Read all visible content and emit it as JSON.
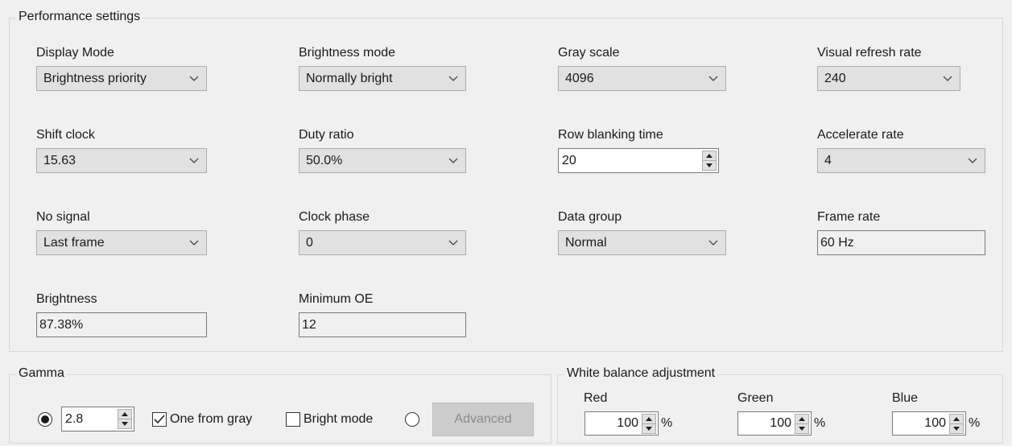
{
  "performance": {
    "title": "Performance settings",
    "fields": {
      "display_mode": {
        "label": "Display Mode",
        "value": "Brightness priority"
      },
      "brightness_mode": {
        "label": "Brightness mode",
        "value": "Normally bright"
      },
      "gray_scale": {
        "label": "Gray scale",
        "value": "4096"
      },
      "visual_refresh_rate": {
        "label": "Visual refresh rate",
        "value": "240"
      },
      "shift_clock": {
        "label": "Shift clock",
        "value": "15.63"
      },
      "duty_ratio": {
        "label": "Duty ratio",
        "value": "50.0%"
      },
      "row_blanking_time": {
        "label": "Row blanking time",
        "value": "20"
      },
      "accelerate_rate": {
        "label": "Accelerate rate",
        "value": "4"
      },
      "no_signal": {
        "label": "No signal",
        "value": "Last frame"
      },
      "clock_phase": {
        "label": "Clock phase",
        "value": "0"
      },
      "data_group": {
        "label": "Data group",
        "value": "Normal"
      },
      "frame_rate": {
        "label": "Frame rate",
        "value": "60 Hz"
      },
      "brightness": {
        "label": "Brightness",
        "value": "87.38%"
      },
      "minimum_oe": {
        "label": "Minimum OE",
        "value": "12"
      }
    }
  },
  "gamma": {
    "title": "Gamma",
    "value": "2.8",
    "value_radio_selected": true,
    "one_from_gray": {
      "label": "One from gray",
      "checked": true
    },
    "bright_mode": {
      "label": "Bright mode",
      "checked": false
    },
    "advanced_radio_selected": false,
    "advanced_label": "Advanced"
  },
  "white_balance": {
    "title": "White balance adjustment",
    "red": {
      "label": "Red",
      "value": "100",
      "unit": "%"
    },
    "green": {
      "label": "Green",
      "value": "100",
      "unit": "%"
    },
    "blue": {
      "label": "Blue",
      "value": "100",
      "unit": "%"
    }
  },
  "icons": {
    "dropdown": "chevron-down-icon",
    "spin": "spin-arrows-icon",
    "check": "checkmark-icon"
  }
}
